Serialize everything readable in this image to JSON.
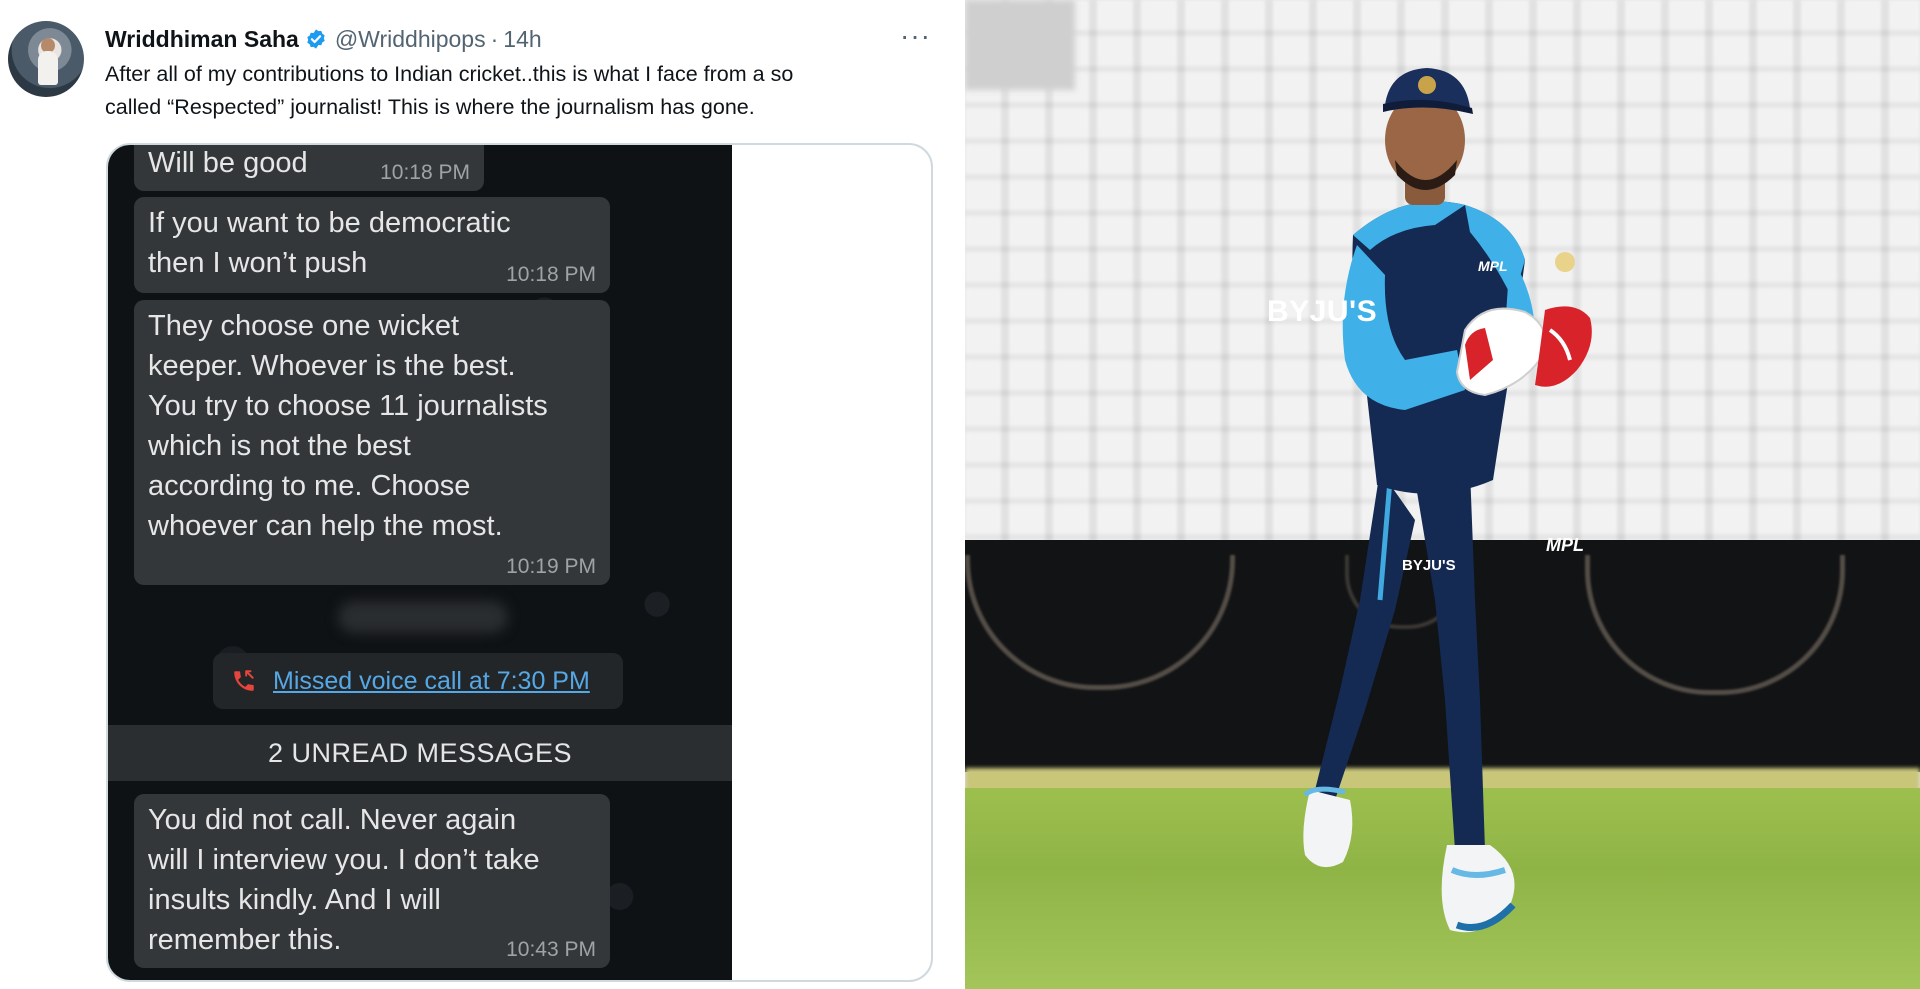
{
  "tweet": {
    "author_name": "Wriddhiman Saha",
    "handle": "@Wriddhipops",
    "separator": "·",
    "time": "14h",
    "more_label": "···",
    "text_line1": "After all of my contributions to Indian cricket..this is what I face from a so",
    "text_line2": "called “Respected” journalist! This is where the journalism has gone.",
    "media": {
      "messages": [
        {
          "text": "Will be good",
          "time": "10:18 PM"
        },
        {
          "text_lines": [
            "If you want to be democratic",
            "then I won’t push"
          ],
          "time": "10:18 PM"
        },
        {
          "text_lines": [
            "They choose one wicket",
            "keeper. Whoever is the best.",
            "You try to choose 11 journalists",
            "which is not the best",
            "according to me. Choose",
            "whoever can help the most."
          ],
          "time": "10:19 PM"
        },
        {
          "text_lines": [
            "You did not call. Never again",
            "will I interview you. I don’t take",
            "insults kindly. And I will",
            "remember this."
          ],
          "time": "10:43 PM"
        }
      ],
      "missed_call": "Missed voice call at 7:30 PM",
      "unread_banner": "2 UNREAD MESSAGES"
    }
  },
  "photo": {
    "shirt_sponsor": "BYJU'S",
    "pants_sponsor": "BYJU'S",
    "kit_brand": "MPL"
  },
  "colors": {
    "link_blue": "#55a8e6",
    "verified_blue": "#1d9bf0",
    "bubble_bg": "#33373a",
    "chat_bg": "#0f1214"
  }
}
